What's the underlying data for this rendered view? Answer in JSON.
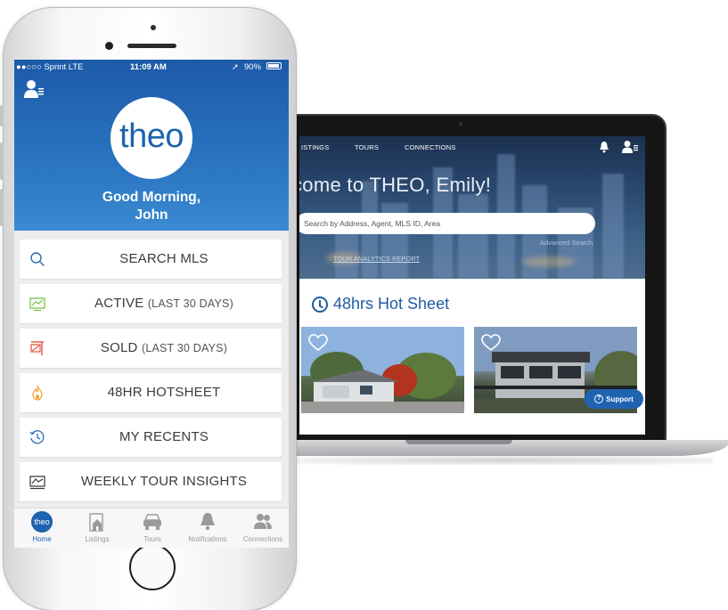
{
  "laptop": {
    "nav": {
      "listings": "ISTINGS",
      "tours": "TOURS",
      "connections": "CONNECTIONS"
    },
    "welcome": "come to THEO, Emily!",
    "search_placeholder": "Search by Address, Agent, MLS ID, Area",
    "advanced_search": "Advanced Search",
    "report_link": "TOUR ANALYTICS REPORT",
    "hotsheet_title": "48hrs Hot Sheet",
    "support_label": "Support",
    "icons": {
      "bell": "bell-icon",
      "user": "user-menu-icon",
      "clock": "clock-icon",
      "heart": "heart-icon",
      "help": "question-icon"
    }
  },
  "phone": {
    "status": {
      "carrier": "●●○○○ Sprint  LTE",
      "time": "11:09 AM",
      "battery": "90%",
      "location_arrow": "➚"
    },
    "logo_text": "theo",
    "greeting_line1": "Good Morning,",
    "greeting_line2": "John",
    "menu": [
      {
        "label": "SEARCH MLS",
        "sub": "",
        "icon": "search-icon",
        "color": "#2b6fb8"
      },
      {
        "label": "ACTIVE",
        "sub": "(LAST 30 DAYS)",
        "icon": "active-listing-icon",
        "color": "#6fbf3a"
      },
      {
        "label": "SOLD",
        "sub": "(LAST 30 DAYS)",
        "icon": "sold-sign-icon",
        "color": "#e2553f"
      },
      {
        "label": "48HR HOTSHEET",
        "sub": "",
        "icon": "flame-icon",
        "color": "#f0a030"
      },
      {
        "label": "MY RECENTS",
        "sub": "",
        "icon": "history-icon",
        "color": "#2b6fb8"
      },
      {
        "label": "WEEKLY TOUR INSIGHTS",
        "sub": "",
        "icon": "tour-chart-icon",
        "color": "#333333"
      }
    ],
    "tabs": [
      {
        "label": "Home",
        "icon": "theo-home-icon"
      },
      {
        "label": "Listings",
        "icon": "listings-icon"
      },
      {
        "label": "Tours",
        "icon": "car-icon"
      },
      {
        "label": "Notifications",
        "icon": "bell-icon"
      },
      {
        "label": "Connections",
        "icon": "people-icon"
      }
    ],
    "home_logo_text": "theo"
  },
  "colors": {
    "brand_blue": "#1d63ad",
    "header_blue": "#2a74c0",
    "support_blue": "#1f63b1"
  }
}
